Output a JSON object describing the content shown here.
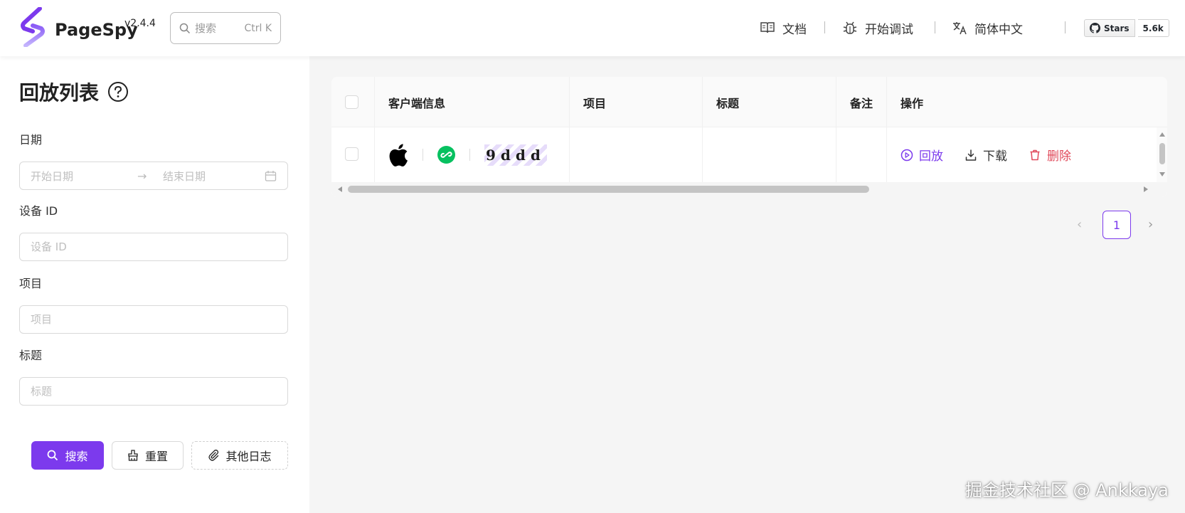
{
  "header": {
    "brand": "PageSpy",
    "version": "v2.4.4",
    "search": {
      "placeholder": "搜索",
      "shortcut": "Ctrl K"
    },
    "nav": [
      {
        "label": "文档",
        "icon": "book-icon"
      },
      {
        "label": "开始调试",
        "icon": "bug-icon"
      },
      {
        "label": "简体中文",
        "icon": "translate-icon"
      }
    ],
    "github": {
      "label": "Stars",
      "count": "5.6k",
      "icon": "github-icon"
    }
  },
  "sidebar": {
    "title": "回放列表",
    "fields": {
      "date": {
        "label": "日期",
        "start_placeholder": "开始日期",
        "arrow": "→",
        "end_placeholder": "结束日期"
      },
      "device_id": {
        "label": "设备 ID",
        "placeholder": "设备 ID"
      },
      "project": {
        "label": "项目",
        "placeholder": "项目"
      },
      "title": {
        "label": "标题",
        "placeholder": "标题"
      }
    },
    "buttons": {
      "search": "搜索",
      "reset": "重置",
      "other_logs": "其他日志"
    }
  },
  "table": {
    "columns": [
      "客户端信息",
      "项目",
      "标题",
      "备注",
      "操作"
    ],
    "rows": [
      {
        "client": {
          "os_icon": "apple-icon",
          "app_icon": "wechat-miniprogram-icon",
          "device_id": "9ddd"
        },
        "project": "--",
        "title": "--",
        "remark": "--",
        "actions": {
          "play": "回放",
          "download": "下载",
          "delete": "删除"
        }
      }
    ]
  },
  "pagination": {
    "current": "1",
    "prev": "‹",
    "next": "›"
  },
  "colors": {
    "primary": "#7c3aed",
    "danger": "#e0495a",
    "wechat": "#07c160"
  },
  "watermark": "掘金技术社区 @ Ankkaya"
}
